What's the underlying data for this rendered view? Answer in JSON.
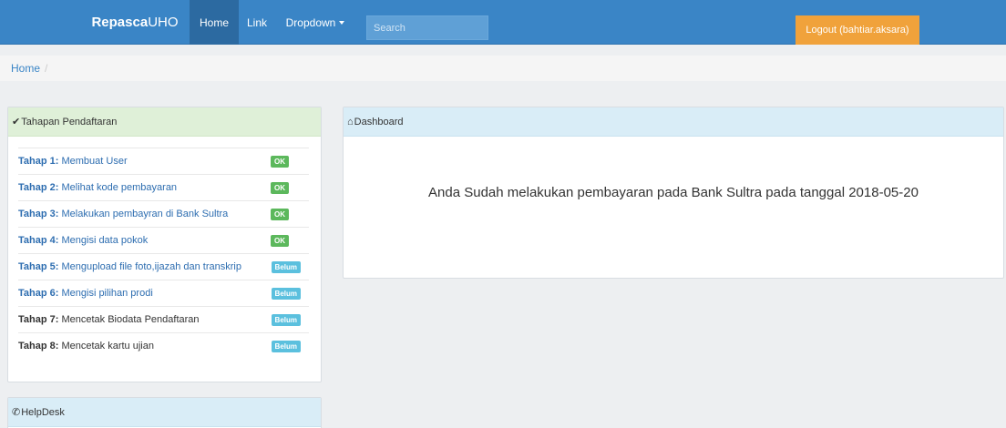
{
  "navbar": {
    "brand_bold": "Repasca",
    "brand_rest": "UHO",
    "home": "Home",
    "link": "Link",
    "dropdown": "Dropdown",
    "search_placeholder": "Search",
    "logout": "Logout (bahtiar.aksara)"
  },
  "breadcrumb": {
    "home": "Home",
    "separator": "/"
  },
  "steps_panel": {
    "icon": "check-icon",
    "title": "Tahapan Pendaftaran",
    "items": [
      {
        "prefix": "Tahap 1:",
        "text": " Membuat User",
        "status": "OK"
      },
      {
        "prefix": "Tahap 2:",
        "text": " Melihat kode pembayaran",
        "status": "OK"
      },
      {
        "prefix": "Tahap 3:",
        "text": " Melakukan pembayran di Bank Sultra",
        "status": "OK"
      },
      {
        "prefix": "Tahap 4:",
        "text": " Mengisi data pokok",
        "status": "OK"
      },
      {
        "prefix": "Tahap 5:",
        "text": " Mengupload file foto,ijazah dan transkrip",
        "status": "Belum"
      },
      {
        "prefix": "Tahap 6:",
        "text": " Mengisi pilihan prodi",
        "status": "Belum"
      },
      {
        "prefix": "Tahap 7:",
        "text": " Mencetak Biodata Pendaftaran",
        "status": "Belum"
      },
      {
        "prefix": "Tahap 8:",
        "text": " Mencetak kartu ujian",
        "status": "Belum"
      }
    ]
  },
  "help_panel": {
    "icon": "phone-icon",
    "title": "HelpDesk"
  },
  "dashboard": {
    "icon": "home-icon",
    "title": "Dashboard",
    "message": "Anda Sudah melakukan pembayaran pada Bank Sultra pada tanggal 2018-05-20"
  },
  "colors": {
    "navbar": "#3a85c6",
    "logout": "#f0a23b",
    "badge_ok": "#5cb85c",
    "badge_belum": "#5bc0de"
  }
}
